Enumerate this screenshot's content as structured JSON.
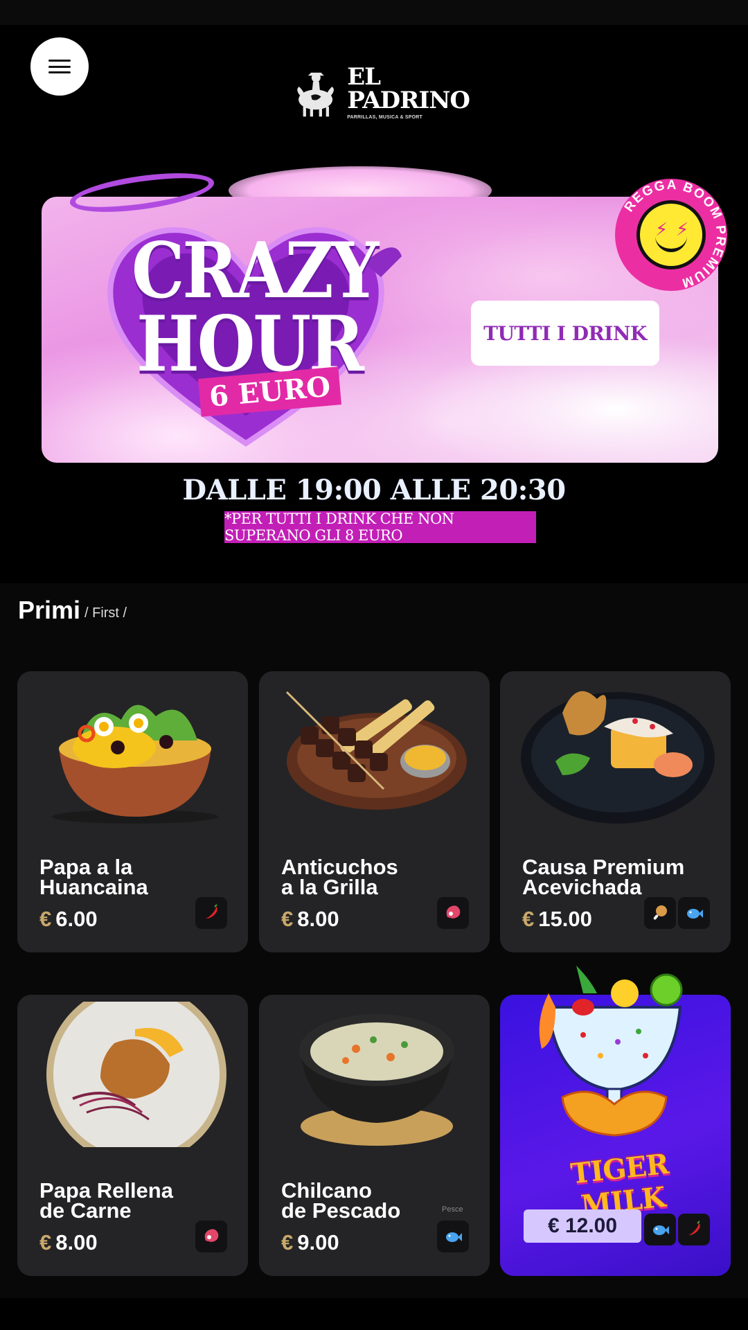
{
  "header": {
    "menu_label": "menu",
    "logo_name": "EL PADRINO",
    "logo_tagline": "PARRILLAS, MUSICA & SPORT"
  },
  "banner": {
    "title": "CRAZY HOUR",
    "price_tag": "6 EURO",
    "cta": "TUTTI I DRINK",
    "sticker": "REGGA BOOM PREMIUM",
    "time": "DALLE 19:00 ALLE 20:30",
    "note": "*PER TUTTI I DRINK CHE NON SUPERANO GLI 8 EURO"
  },
  "section": {
    "title": "Primi",
    "subtitle": "/ First /"
  },
  "currency": "€",
  "cards": [
    {
      "name_line1": "Papa a la",
      "name_line2": "Huancaina",
      "price": "6.00",
      "badges": [
        "chili-icon"
      ]
    },
    {
      "name_line1": "Anticuchos",
      "name_line2": "a la Grilla",
      "price": "8.00",
      "badges": [
        "meat-icon"
      ]
    },
    {
      "name_line1": "Causa Premium",
      "name_line2": "Acevichada",
      "price": "15.00",
      "badges": [
        "chicken-leg-icon",
        "fish-icon"
      ]
    },
    {
      "name_line1": "Papa Rellena",
      "name_line2": "de Carne",
      "price": "8.00",
      "badges": [
        "meat-icon"
      ]
    },
    {
      "name_line1": "Chilcano",
      "name_line2": "de Pescado",
      "price": "9.00",
      "badge_label": "Pesce",
      "badges": [
        "fish-icon"
      ]
    }
  ],
  "feature_card": {
    "title": "TIGER MILK",
    "price": "€ 12.00",
    "badges": [
      "fish-icon",
      "chili-icon"
    ]
  },
  "colors": {
    "accent_pink": "#c21fb7",
    "price_gold": "#c9a86b",
    "card_bg": "#242426",
    "feature_bg": "#4a16e4"
  }
}
